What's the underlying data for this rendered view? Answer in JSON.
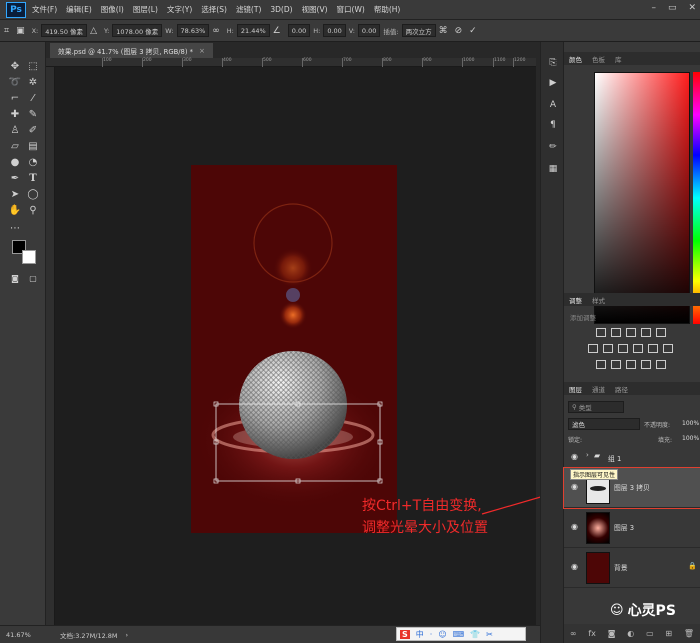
{
  "app": {
    "logo": "Ps",
    "menu": [
      "文件(F)",
      "编辑(E)",
      "图像(I)",
      "图层(L)",
      "文字(Y)",
      "选择(S)",
      "滤镜(T)",
      "3D(D)",
      "视图(V)",
      "窗口(W)",
      "帮助(H)"
    ]
  },
  "options": {
    "x_label": "X:",
    "x_value": "419.50 像素",
    "y_label": "Y:",
    "y_value": "1078.00 像素",
    "w_label": "W:",
    "w_value": "78.63%",
    "h_label": "H:",
    "h_value": "21.44%",
    "angle_value": "0.00",
    "hskew_label": "H:",
    "hskew_value": "0.00",
    "vskew_label": "V:",
    "vskew_value": "0.00",
    "interp_label": "插值:",
    "interp_value": "两次立方"
  },
  "document": {
    "tab_title": "效果.psd @ 41.7% (图层 3 拷贝, RGB/8) *",
    "tab_close": "×"
  },
  "ruler_ticks": [
    "100",
    "200",
    "300",
    "400",
    "500",
    "600",
    "700",
    "800",
    "900",
    "1000",
    "1100",
    "1200"
  ],
  "status": {
    "zoom": "41.67%",
    "doc_info": "文档:3.27M/12.8M"
  },
  "ime": [
    "S",
    "中",
    "·",
    "☺",
    "⌨",
    "👕",
    "✂"
  ],
  "color_panel": {
    "tabs": [
      "颜色",
      "色板",
      "库"
    ]
  },
  "adjust_panel": {
    "tabs": [
      "调整",
      "样式"
    ],
    "subtitle": "添加调整"
  },
  "layers_panel": {
    "tabs": [
      "图层",
      "通道",
      "路径"
    ],
    "search_placeholder": "类型",
    "blend_mode": "滤色",
    "opacity_label": "不透明度:",
    "opacity_value": "100%",
    "lock_label": "锁定:",
    "fill_label": "填充:",
    "fill_value": "100%",
    "tooltip": "指示图层可见性",
    "layers": [
      {
        "name": "组 1",
        "kind": "group"
      },
      {
        "name": "图层 3 拷贝",
        "kind": "layer",
        "selected": true
      },
      {
        "name": "图层 3",
        "kind": "layer"
      },
      {
        "name": "背景",
        "kind": "background"
      }
    ]
  },
  "annotation": {
    "line1": "按Ctrl+T自由变换,",
    "line2": "调整光晕大小及位置"
  },
  "watermark": "心灵PS",
  "colors": {
    "canvas_bg": "#4d0606",
    "accent_red": "#f02a2a",
    "ps_blue": "#31a8ff"
  }
}
